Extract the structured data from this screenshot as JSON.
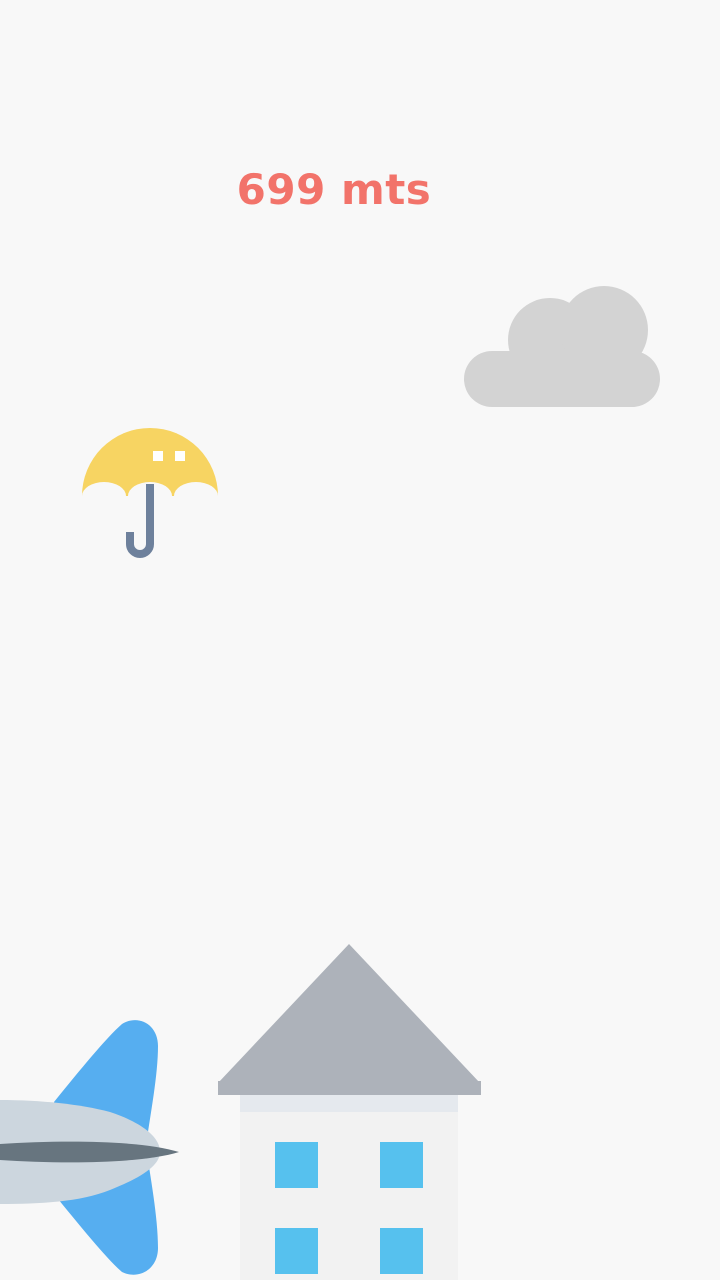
{
  "hud": {
    "distance": "699 mts"
  },
  "sprites": {
    "player": "umbrella-icon",
    "cloud": "cloud-icon",
    "building": "house-icon",
    "obstacle": "airplane-icon"
  },
  "colors": {
    "background": "#f8f8f8",
    "score": "#f2736a",
    "umbrella_canopy": "#f7d462",
    "umbrella_handle": "#6e819c",
    "cloud": "#d3d3d3",
    "roof": "#adb2ba",
    "wall": "#f2f2f2",
    "window": "#56c1ee",
    "plane_body": "#ccd6de",
    "plane_wing": "#56aef0",
    "plane_stripe": "#67757f"
  }
}
